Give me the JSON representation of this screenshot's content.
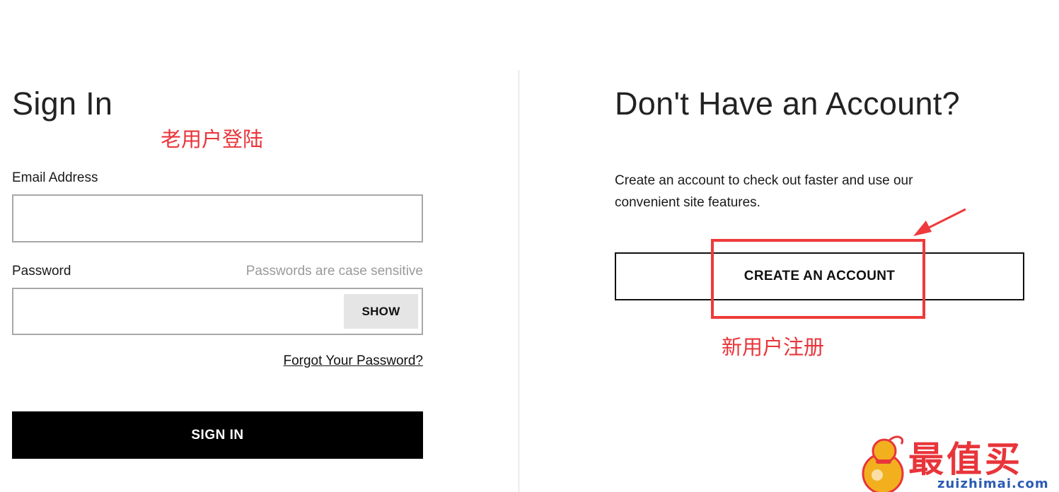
{
  "signin": {
    "title": "Sign In",
    "annotation": "老用户登陆",
    "email_label": "Email Address",
    "email_value": "",
    "password_label": "Password",
    "password_hint": "Passwords are case sensitive",
    "password_value": "",
    "show_label": "SHOW",
    "forgot_label": "Forgot Your Password?",
    "submit_label": "SIGN IN"
  },
  "register": {
    "title": "Don't Have an Account?",
    "description_line1": "Create an account to check out faster and use our",
    "description_line2": "convenient site features.",
    "create_label": "CREATE AN ACCOUNT",
    "annotation": "新用户注册"
  },
  "watermark": {
    "text": "最值买",
    "url": "zuizhimai.com"
  },
  "colors": {
    "annotation_red": "#e8353a",
    "primary_button": "#000000",
    "watermark_blue": "#2c5bb5",
    "watermark_gold": "#f2b01e"
  }
}
